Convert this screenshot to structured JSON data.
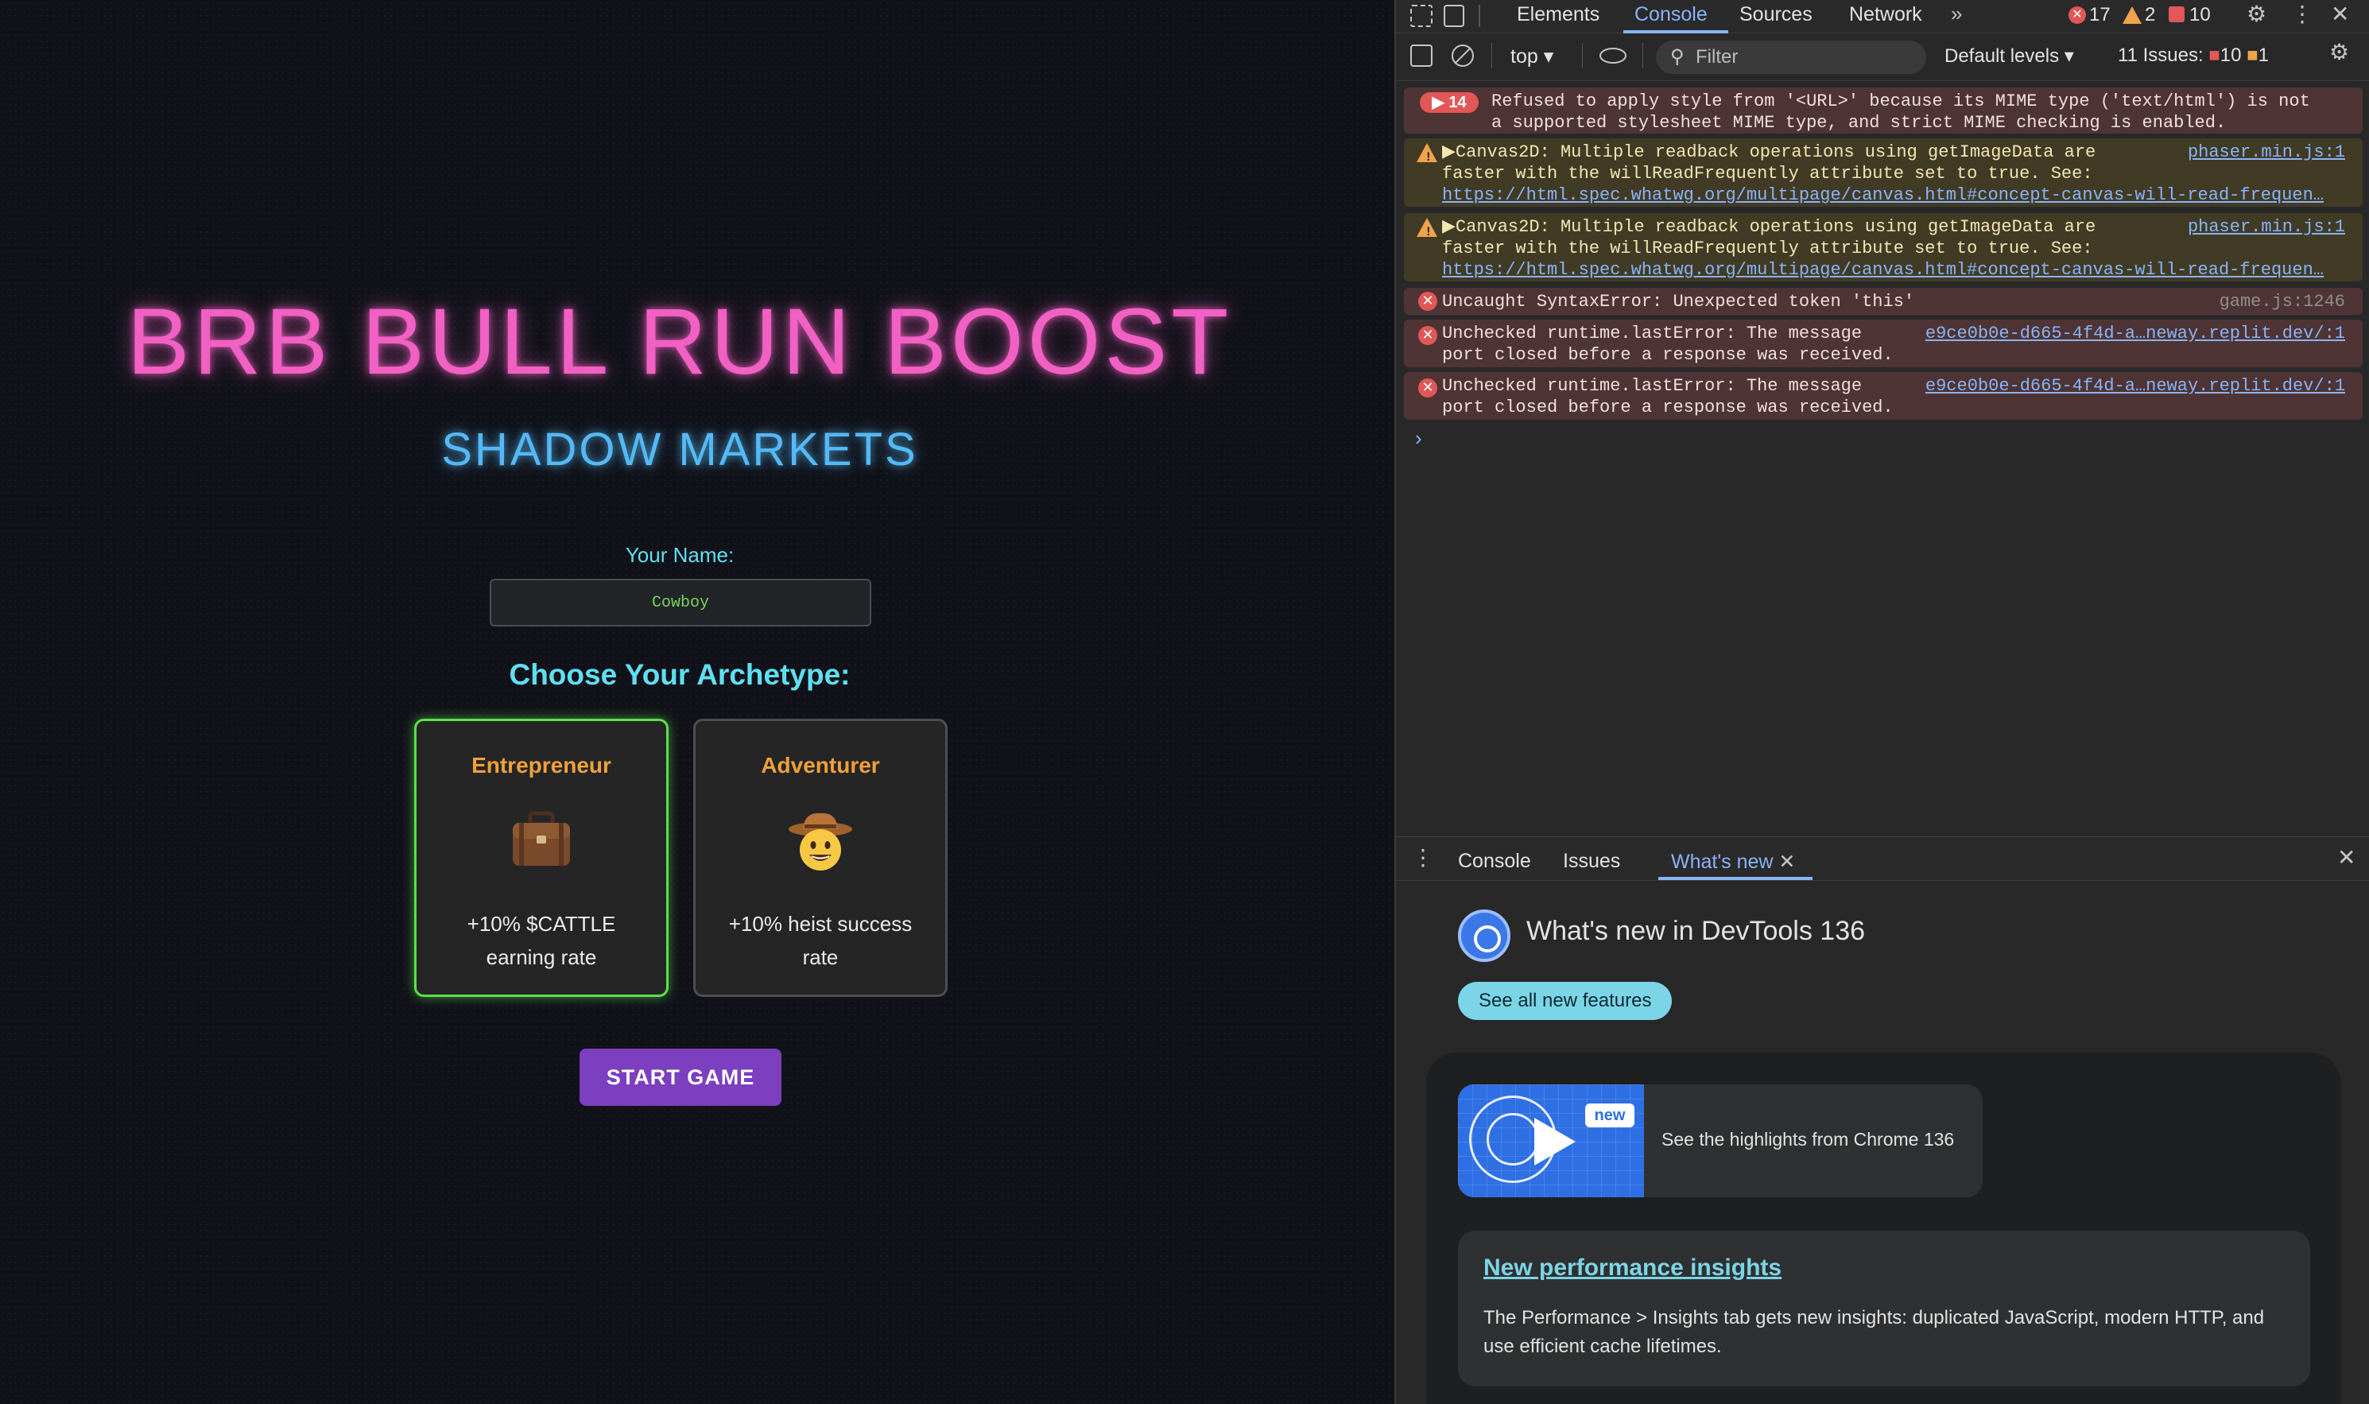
{
  "game": {
    "title": "BRB BULL RUN BOOST",
    "subtitle": "SHADOW MARKETS",
    "name_label": "Your Name:",
    "name_value": "Cowboy",
    "choose_label": "Choose Your Archetype:",
    "archetypes": [
      {
        "name": "Entrepreneur",
        "icon": "briefcase-icon",
        "emoji": "💼",
        "desc": "+10% $CATTLE earning rate",
        "selected": true
      },
      {
        "name": "Adventurer",
        "icon": "cowboy-face-icon",
        "emoji": "🤠",
        "desc": "+10% heist success rate",
        "selected": false
      }
    ],
    "start_label": "START GAME",
    "colors": {
      "title": "#f160c3",
      "subtitle": "#55b9f5",
      "accent": "#5ee0f2",
      "selected_border": "#58e34a",
      "button": "#7b3fbf"
    }
  },
  "devtools": {
    "tabs": {
      "elements": "Elements",
      "console": "Console",
      "sources": "Sources",
      "network": "Network"
    },
    "counts": {
      "errors": "17",
      "warnings": "2",
      "issues": "10"
    },
    "toolbar": {
      "context": "top",
      "filter_placeholder": "Filter",
      "levels": "Default levels",
      "issues_label": "11 Issues:",
      "issues_errors": "10",
      "issues_warnings": "1"
    },
    "messages": [
      {
        "type": "error",
        "badge": "14",
        "text": "Refused to apply style from '<URL>' because its MIME type ('text/html') is not\na supported stylesheet MIME type, and strict MIME checking is enabled."
      },
      {
        "type": "warning",
        "text": "▶Canvas2D: Multiple readback operations using getImageData are\nfaster with the willReadFrequently attribute set to true. See:",
        "link": "https://html.spec.whatwg.org/multipage/canvas.html#concept-canvas-will-read-frequen…",
        "source": "phaser.min.js:1"
      },
      {
        "type": "warning",
        "text": "▶Canvas2D: Multiple readback operations using getImageData are\nfaster with the willReadFrequently attribute set to true. See:",
        "link": "https://html.spec.whatwg.org/multipage/canvas.html#concept-canvas-will-read-frequen…",
        "source": "phaser.min.js:1"
      },
      {
        "type": "error",
        "text": "Uncaught SyntaxError: Unexpected token 'this'",
        "source": "game.js:1246"
      },
      {
        "type": "error",
        "text": "Unchecked runtime.lastError: The message\nport closed before a response was received.",
        "source": "e9ce0b0e-d665-4f4d-a…neway.replit.dev/:1"
      },
      {
        "type": "error",
        "text": "Unchecked runtime.lastError: The message\nport closed before a response was received.",
        "source": "e9ce0b0e-d665-4f4d-a…neway.replit.dev/:1"
      }
    ],
    "prompt": "›",
    "drawer": {
      "tabs": {
        "console": "Console",
        "issues": "Issues",
        "whats_new": "What's new"
      },
      "title": "What's new in DevTools 136",
      "see_all": "See all new features",
      "video_badge": "new",
      "video_text": "See the highlights from Chrome 136",
      "insight_title": "New performance insights",
      "insight_body": "The Performance > Insights tab gets new insights: duplicated JavaScript, modern HTTP, and use efficient cache lifetimes."
    }
  }
}
